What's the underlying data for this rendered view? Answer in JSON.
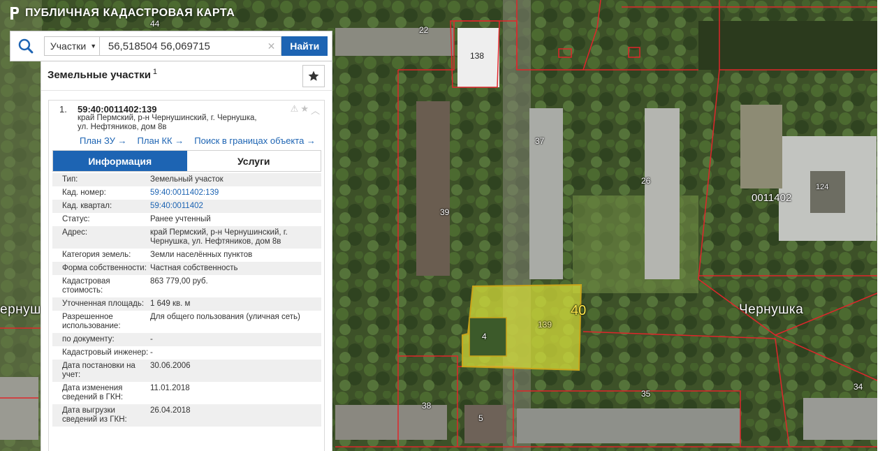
{
  "header": {
    "title": "ПУБЛИЧНАЯ КАДАСТРОВАЯ КАРТА"
  },
  "search": {
    "type_value": "Участки",
    "query": "56,518504 56,069715",
    "find_label": "Найти"
  },
  "panel": {
    "title": "Земельные участки",
    "count": "1"
  },
  "result": {
    "number": "1.",
    "cadnum": "59:40:0011402:139",
    "address_line1": "край Пермский, р-н Чернушинский, г. Чернушка,",
    "address_line2": "ул. Нефтяников, дом 8в",
    "links": {
      "plan_zu": "План ЗУ →",
      "plan_kk": "План КК →",
      "search_in": "Поиск в границах объекта →"
    }
  },
  "tabs": {
    "info": "Информация",
    "services": "Услуги"
  },
  "info": {
    "type_k": "Тип:",
    "type_v": "Земельный участок",
    "cadnum_k": "Кад. номер:",
    "cadnum_v": "59:40:0011402:139",
    "quarter_k": "Кад. квартал:",
    "quarter_v": "59:40:0011402",
    "status_k": "Статус:",
    "status_v": "Ранее учтенный",
    "address_k": "Адрес:",
    "address_v": "край Пермский, р-н Чернушинский, г. Чернушка, ул. Нефтяников, дом 8в",
    "category_k": "Категория земель:",
    "category_v": "Земли населённых пунктов",
    "ownership_k": "Форма собственности:",
    "ownership_v": "Частная собственность",
    "cost_k": "Кадастровая стоимость:",
    "cost_v": "863 779,00 руб.",
    "area_k": "Уточненная площадь:",
    "area_v": "1 649 кв. м",
    "usage_k": "Разрешенное использование:",
    "usage_v": "Для общего пользования (уличная сеть)",
    "bydoc_k": "по документу:",
    "bydoc_v": "-",
    "engineer_k": "Кадастровый инженер:",
    "engineer_v": "-",
    "reg_date_k": "Дата постановки на учет:",
    "reg_date_v": "30.06.2006",
    "change_date_k": "Дата изменения сведений в ГКН:",
    "change_date_v": "11.01.2018",
    "export_date_k": "Дата выгрузки сведений из ГКН:",
    "export_date_v": "26.04.2018"
  },
  "map": {
    "labels": {
      "n44": "44",
      "n22": "22",
      "n138": "138",
      "n37": "37",
      "n26": "26",
      "n39": "39",
      "n124": "124",
      "quarter": "0011402",
      "n40": "40",
      "n139": "139",
      "n4": "4",
      "town": "Чернушка",
      "town_left": "ернуш",
      "n38": "38",
      "n5": "5",
      "n35": "35",
      "n34": "34"
    },
    "colors": {
      "boundary": "#e0262b",
      "selected_fill": "#d8e03a",
      "selected_stroke": "#c9a41a"
    }
  }
}
